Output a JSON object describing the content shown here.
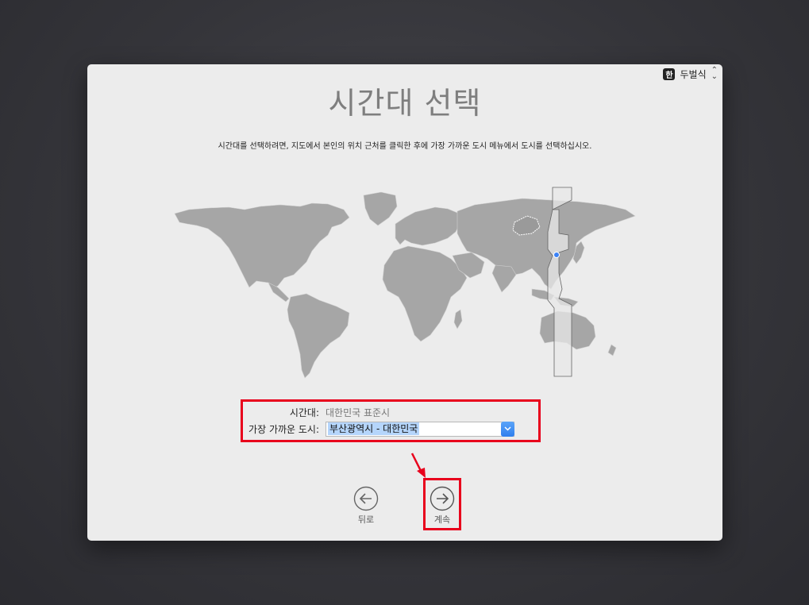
{
  "keyboard": {
    "badge": "한",
    "layout": "두벌식",
    "chevron": "⌃⌄"
  },
  "title": "시간대 선택",
  "instruction": "시간대를 선택하려면, 지도에서 본인의 위치 근처를 클릭한 후에 가장 가까운 도시 메뉴에서 도시를 선택하십시오.",
  "form": {
    "timezone_label": "시간대:",
    "timezone_value": "대한민국 표준시",
    "city_label": "가장 가까운 도시:",
    "city_value": "부산광역시 - 대한민국"
  },
  "nav": {
    "back_label": "뒤로",
    "continue_label": "계속"
  },
  "colors": {
    "highlight": "#e8001c",
    "accent": "#2f7fee",
    "map_land": "#a6a6a6"
  }
}
